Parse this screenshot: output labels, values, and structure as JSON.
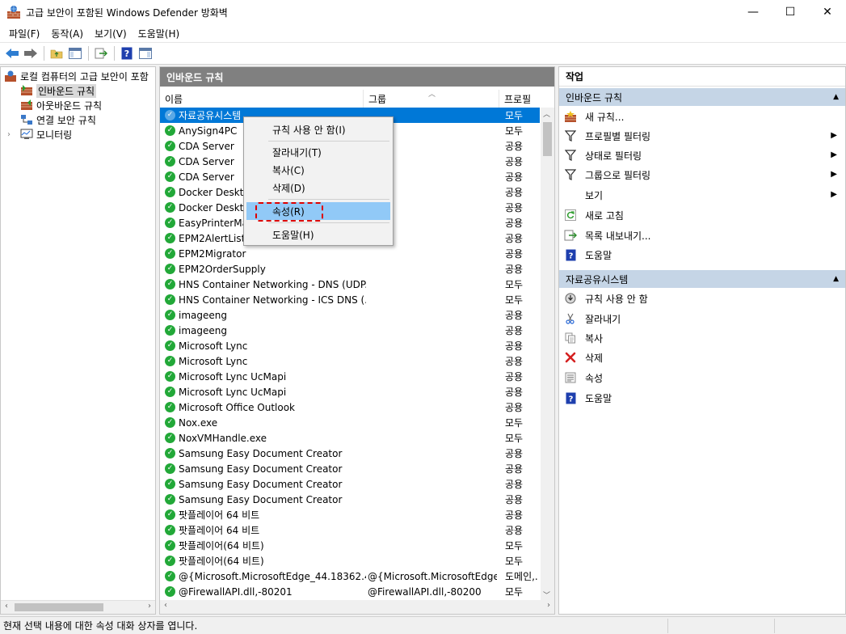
{
  "window": {
    "title": "고급 보안이 포함된 Windows Defender 방화벽",
    "controls": [
      "—",
      "☐",
      "✕"
    ]
  },
  "menubar": [
    "파일(F)",
    "동작(A)",
    "보기(V)",
    "도움말(H)"
  ],
  "tree": {
    "root": "로컬 컴퓨터의 고급 보안이 포함",
    "items": [
      "인바운드 규칙",
      "아웃바운드 규칙",
      "연결 보안 규칙",
      "모니터링"
    ],
    "selected_index": 0
  },
  "middle": {
    "header": "인바운드 규칙",
    "columns": {
      "name": "이름",
      "group": "그룹",
      "profile": "프로필"
    },
    "rows": [
      {
        "name": "자료공유시스템",
        "group": "",
        "profile": "모두"
      },
      {
        "name": "AnySign4PC",
        "group": "",
        "profile": "모두"
      },
      {
        "name": "CDA Server",
        "group": "",
        "profile": "공용"
      },
      {
        "name": "CDA Server",
        "group": "",
        "profile": "공용"
      },
      {
        "name": "CDA Server",
        "group": "",
        "profile": "공용"
      },
      {
        "name": "Docker Desktop",
        "group": "",
        "profile": "공용"
      },
      {
        "name": "Docker Desktop",
        "group": "",
        "profile": "공용"
      },
      {
        "name": "EasyPrinterManager",
        "group": "",
        "profile": "공용"
      },
      {
        "name": "EPM2AlertList",
        "group": "",
        "profile": "공용"
      },
      {
        "name": "EPM2Migrator",
        "group": "",
        "profile": "공용"
      },
      {
        "name": "EPM2OrderSupply",
        "group": "",
        "profile": "공용"
      },
      {
        "name": "HNS Container Networking - DNS (UDP...",
        "group": "",
        "profile": "모두"
      },
      {
        "name": "HNS Container Networking - ICS DNS (...",
        "group": "",
        "profile": "모두"
      },
      {
        "name": "imageeng",
        "group": "",
        "profile": "공용"
      },
      {
        "name": "imageeng",
        "group": "",
        "profile": "공용"
      },
      {
        "name": "Microsoft Lync",
        "group": "",
        "profile": "공용"
      },
      {
        "name": "Microsoft Lync",
        "group": "",
        "profile": "공용"
      },
      {
        "name": "Microsoft Lync UcMapi",
        "group": "",
        "profile": "공용"
      },
      {
        "name": "Microsoft Lync UcMapi",
        "group": "",
        "profile": "공용"
      },
      {
        "name": "Microsoft Office Outlook",
        "group": "",
        "profile": "공용"
      },
      {
        "name": "Nox.exe",
        "group": "",
        "profile": "모두"
      },
      {
        "name": "NoxVMHandle.exe",
        "group": "",
        "profile": "모두"
      },
      {
        "name": "Samsung Easy Document Creator",
        "group": "",
        "profile": "공용"
      },
      {
        "name": "Samsung Easy Document Creator",
        "group": "",
        "profile": "공용"
      },
      {
        "name": "Samsung Easy Document Creator",
        "group": "",
        "profile": "공용"
      },
      {
        "name": "Samsung Easy Document Creator",
        "group": "",
        "profile": "공용"
      },
      {
        "name": "팟플레이어 64 비트",
        "group": "",
        "profile": "공용"
      },
      {
        "name": "팟플레이어 64 비트",
        "group": "",
        "profile": "공용"
      },
      {
        "name": "팟플레이어(64 비트)",
        "group": "",
        "profile": "모두"
      },
      {
        "name": "팟플레이어(64 비트)",
        "group": "",
        "profile": "모두"
      },
      {
        "name": "@{Microsoft.MicrosoftEdge_44.18362.4...",
        "group": "@{Microsoft.MicrosoftEdge...",
        "profile": "도메인,..."
      },
      {
        "name": "@FirewallAPI.dll,-80201",
        "group": "@FirewallAPI.dll,-80200",
        "profile": "모두"
      }
    ],
    "selected_index": 0
  },
  "context_menu": {
    "items": [
      "규칙 사용 안 함(I)",
      "잘라내기(T)",
      "복사(C)",
      "삭제(D)",
      "속성(R)",
      "도움말(H)"
    ],
    "highlighted_index": 4
  },
  "actions": {
    "title": "작업",
    "section1": "인바운드 규칙",
    "section1_items": [
      "새 규칙...",
      "프로필별 필터링",
      "상태로 필터링",
      "그룹으로 필터링",
      "보기",
      "새로 고침",
      "목록 내보내기...",
      "도움말"
    ],
    "section2": "자료공유시스템",
    "section2_items": [
      "규칙 사용 안 함",
      "잘라내기",
      "복사",
      "삭제",
      "속성",
      "도움말"
    ]
  },
  "statusbar": {
    "text": "현재 선택 내용에 대한 속성 대화 상자를 엽니다."
  },
  "colors": {
    "selection": "#0078d7",
    "menu_highlight": "#91c9f7",
    "section_bg": "#c5d5e6",
    "header_bg": "#808080",
    "enabled_check": "#22a838",
    "annotation": "#dd0000"
  }
}
